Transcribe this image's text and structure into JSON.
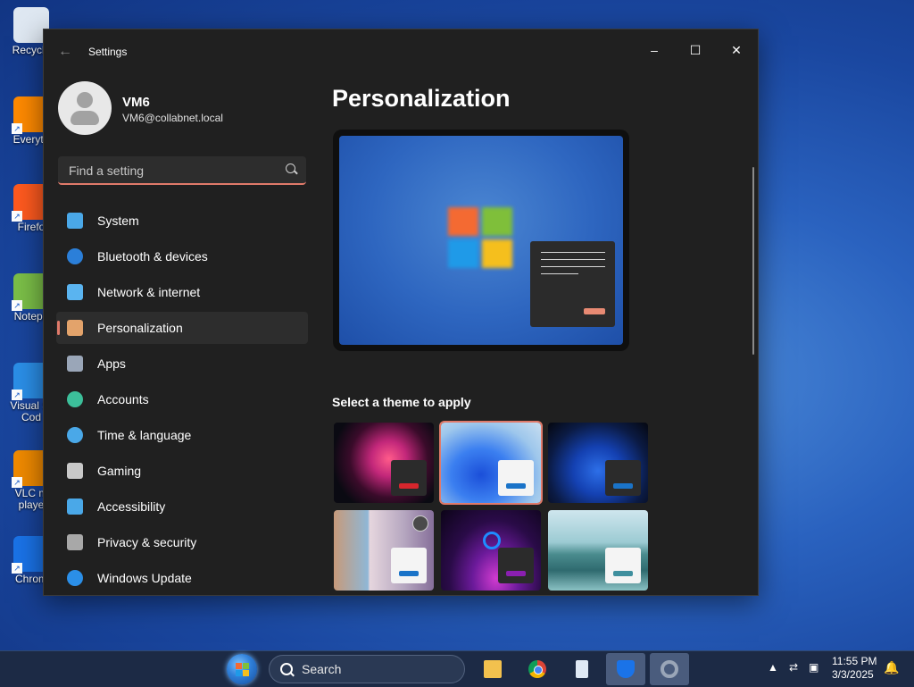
{
  "desktop": {
    "icons": [
      {
        "label": "Recycle",
        "color": "#dfe8f2"
      },
      {
        "label": "Everyth",
        "color": "#ff8a00"
      },
      {
        "label": "Firefo",
        "color": "#ff5a1f"
      },
      {
        "label": "Notepa",
        "color": "#7bbf48"
      },
      {
        "label": "Visual St Cod",
        "color": "#2b8fe8"
      },
      {
        "label": "VLC m playe",
        "color": "#f08a00"
      },
      {
        "label": "Chrom",
        "color": "#1a73e8"
      }
    ]
  },
  "window": {
    "title": "Settings",
    "back_icon": "back-arrow-icon",
    "controls": {
      "minimize": "–",
      "maximize": "☐",
      "close": "✕"
    }
  },
  "profile": {
    "name": "VM6",
    "email": "VM6@collabnet.local"
  },
  "search": {
    "placeholder": "Find a setting",
    "value": ""
  },
  "nav": {
    "items": [
      {
        "label": "System",
        "icon": "monitor-icon",
        "color": "#4aa8e8"
      },
      {
        "label": "Bluetooth & devices",
        "icon": "bluetooth-icon",
        "color": "#2b7fd9"
      },
      {
        "label": "Network & internet",
        "icon": "wifi-icon",
        "color": "#5ab4f0"
      },
      {
        "label": "Personalization",
        "icon": "brush-icon",
        "color": "#e3a36b"
      },
      {
        "label": "Apps",
        "icon": "apps-icon",
        "color": "#9aa6b8"
      },
      {
        "label": "Accounts",
        "icon": "person-icon",
        "color": "#3cbf9a"
      },
      {
        "label": "Time & language",
        "icon": "globe-clock-icon",
        "color": "#4aa8e8"
      },
      {
        "label": "Gaming",
        "icon": "gamepad-icon",
        "color": "#c9c9c9"
      },
      {
        "label": "Accessibility",
        "icon": "accessibility-icon",
        "color": "#4aa8e8"
      },
      {
        "label": "Privacy & security",
        "icon": "shield-icon",
        "color": "#a8a8a8"
      },
      {
        "label": "Windows Update",
        "icon": "update-icon",
        "color": "#2b8fe8"
      }
    ],
    "active_index": 3
  },
  "main": {
    "title": "Personalization",
    "themes_label": "Select a theme to apply",
    "themes": [
      {
        "name": "theme-1",
        "card_color": "#2b2b2b",
        "bar_color": "#d7262d"
      },
      {
        "name": "theme-2",
        "card_color": "#f4f4f4",
        "bar_color": "#1a73c8",
        "selected": true
      },
      {
        "name": "theme-3",
        "card_color": "#2b2b2b",
        "bar_color": "#1a73c8"
      },
      {
        "name": "theme-4",
        "card_color": "#f4f4f4",
        "bar_color": "#1a73c8"
      },
      {
        "name": "theme-5",
        "card_color": "#2b2b2b",
        "bar_color": "#8a1fb0"
      },
      {
        "name": "theme-6",
        "card_color": "#f4f4f4",
        "bar_color": "#3f8f9e"
      }
    ],
    "accent_color": "#e07a6a"
  },
  "taskbar": {
    "search_label": "Search",
    "apps": [
      "file-explorer-icon",
      "chrome-icon",
      "notepad-icon",
      "defender-icon",
      "settings-icon"
    ],
    "tray": {
      "chevron": "▲",
      "time": "11:55 PM",
      "date": "3/3/2025"
    }
  }
}
